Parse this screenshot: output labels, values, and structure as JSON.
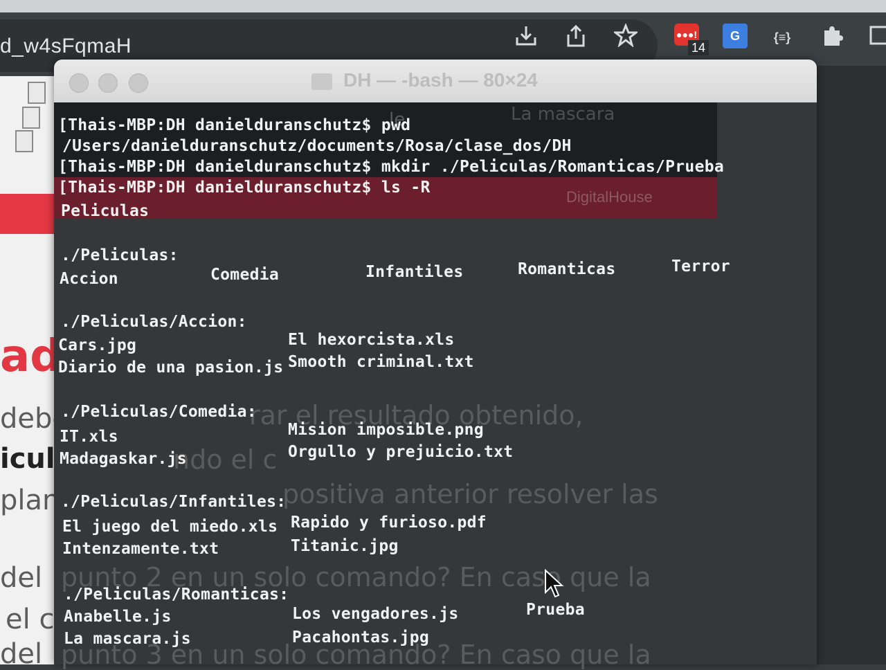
{
  "browser": {
    "url_text": "d_w4sFqmaH",
    "toolbar": {
      "download_icon": "download-icon",
      "share_icon": "share-icon",
      "star_icon": "star-icon",
      "extension_badge": "14",
      "extension_label": "●●●!",
      "translate_label": "G",
      "json_label": "{≡}",
      "puzzle_icon": "puzzle-icon"
    }
  },
  "slide": {
    "big_text": "adc",
    "lines": [
      "debe",
      "icul",
      "plan",
      "del",
      "el c",
      "del"
    ],
    "overlay_lines": [
      "rar el resultado obtenido,",
      "ndo el c",
      "positiva anterior resolver las",
      "punto 2 en un solo comando? En caso que la",
      "punto 3 en un solo comando? En caso que la"
    ],
    "ghost_le": "le",
    "ghost_mascara": "La mascara",
    "ghost_logo": "DigitalHouse"
  },
  "terminal": {
    "title": "DH — -bash — 80×24",
    "lines": {
      "l1": "[Thais-MBP:DH danielduranschutz$ pwd",
      "l2": "/Users/danielduranschutz/documents/Rosa/clase_dos/DH",
      "l3": "[Thais-MBP:DH danielduranschutz$ mkdir ./Peliculas/Romanticas/Prueba",
      "l4": "[Thais-MBP:DH danielduranschutz$ ls -R",
      "l5": "Peliculas"
    },
    "peliculas": {
      "header": "./Peliculas:",
      "items": [
        "Accion",
        "Comedia",
        "Infantiles",
        "Romanticas",
        "Terror"
      ]
    },
    "accion": {
      "header": "./Peliculas/Accion:",
      "c1": [
        "Cars.jpg",
        "Diario de una pasion.js"
      ],
      "c2": [
        "El hexorcista.xls",
        "Smooth criminal.txt"
      ]
    },
    "comedia": {
      "header": "./Peliculas/Comedia:",
      "c1": [
        "IT.xls",
        "Madagaskar.js"
      ],
      "c2": [
        "Mision imposible.png",
        "Orgullo y prejuicio.txt"
      ]
    },
    "infantiles": {
      "header": "./Peliculas/Infantiles:",
      "c1": [
        "El juego del miedo.xls",
        "Intenzamente.txt"
      ],
      "c2": [
        "Rapido y furioso.pdf",
        "Titanic.jpg"
      ]
    },
    "romanticas": {
      "header": "./Peliculas/Romanticas:",
      "c1": [
        "Anabelle.js",
        "La mascara.js"
      ],
      "c2": [
        "Los vengadores.js",
        "Pacahontas.jpg"
      ],
      "c3": [
        "Prueba"
      ]
    }
  }
}
